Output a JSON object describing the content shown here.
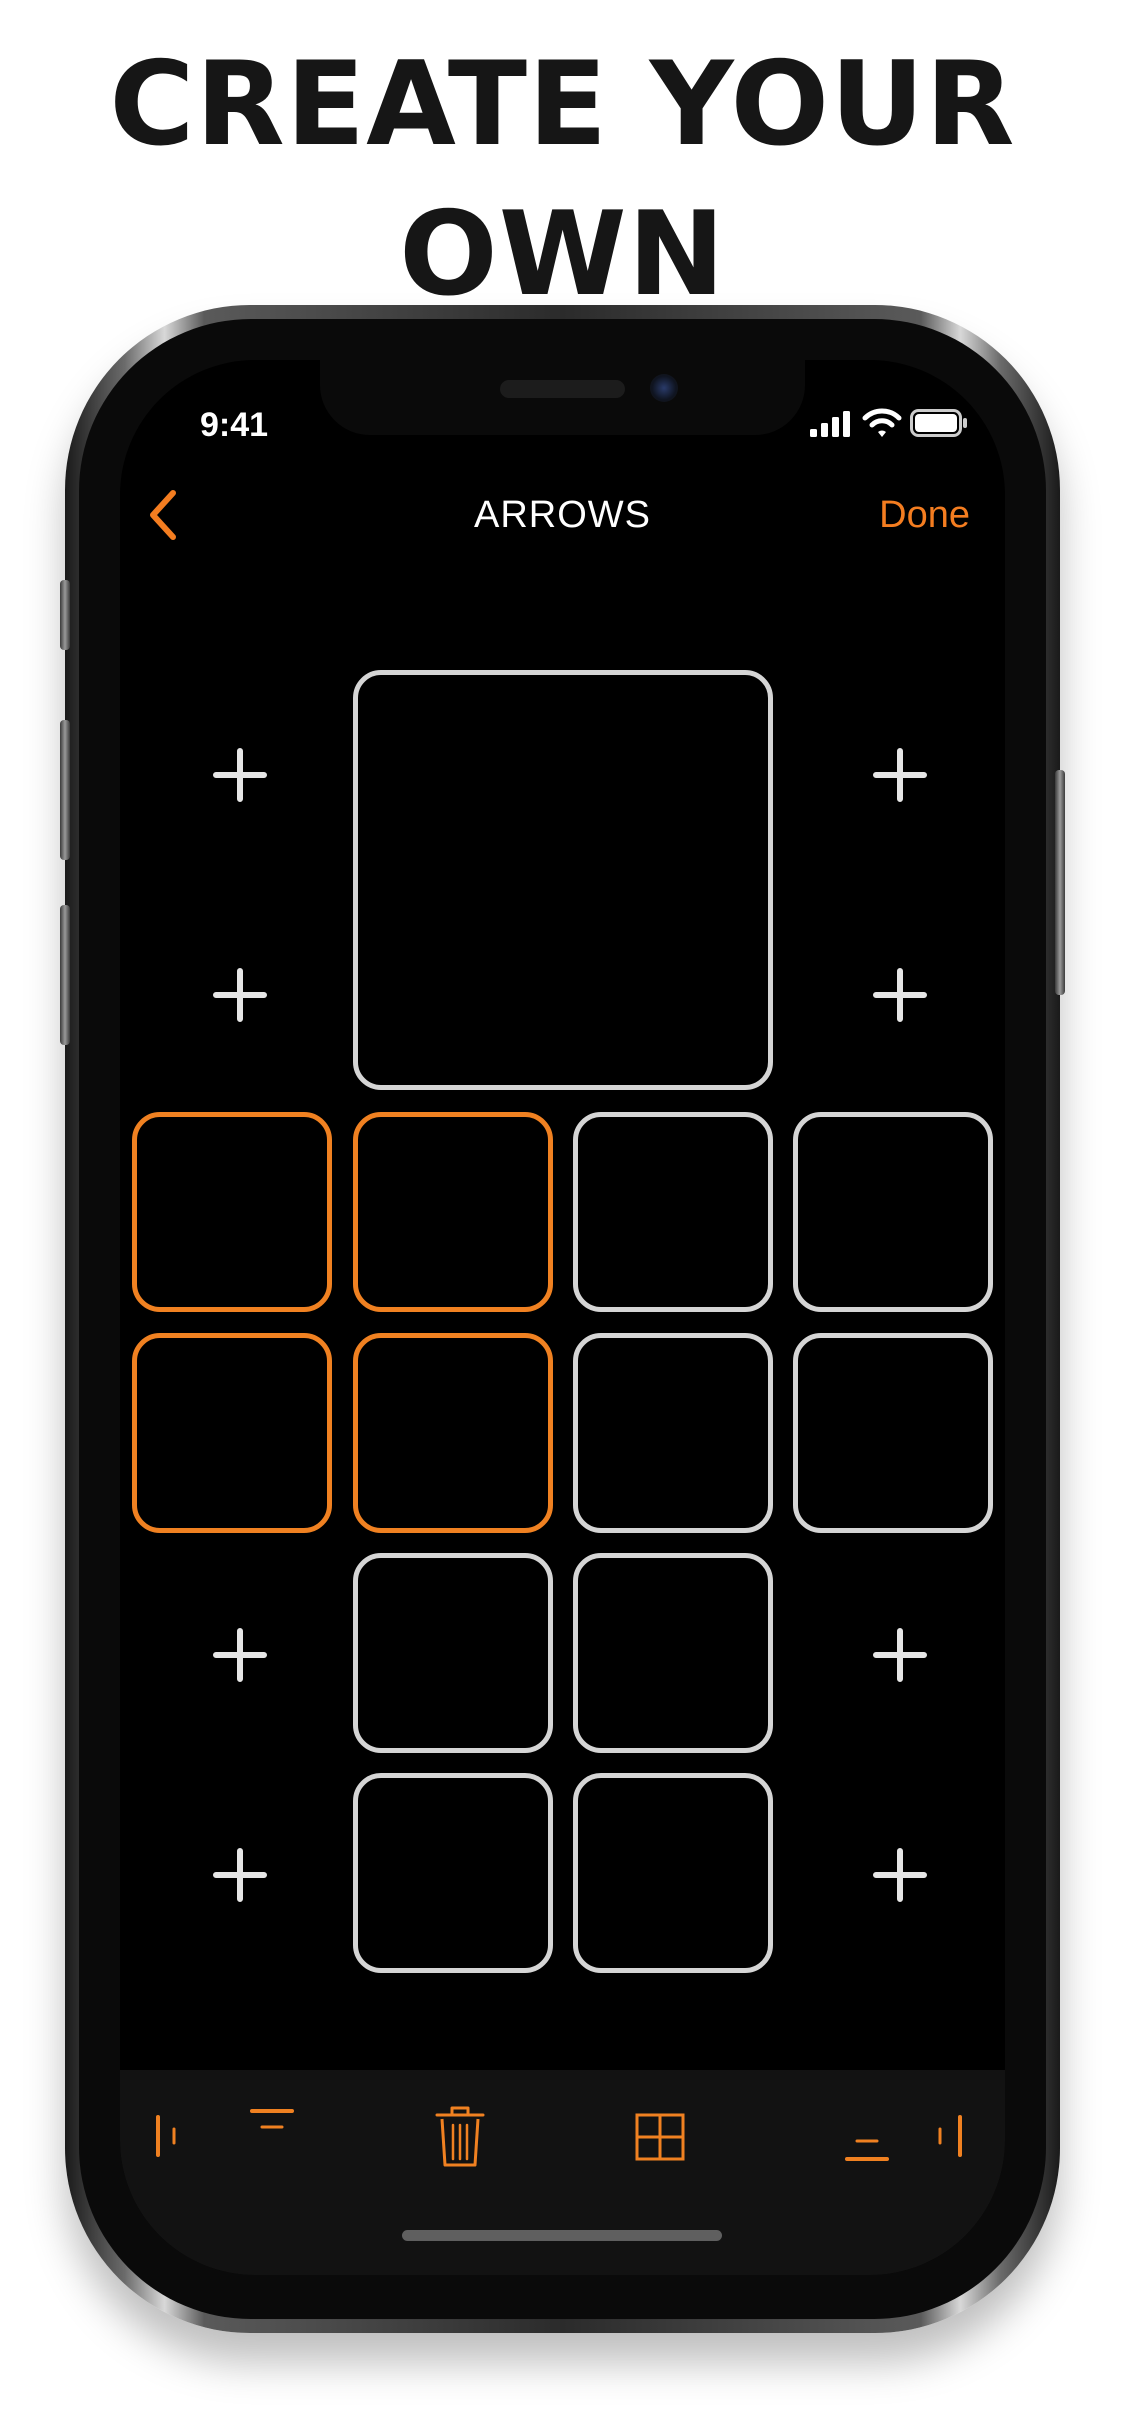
{
  "headline": "CREATE YOUR OWN",
  "status_bar": {
    "time": "9:41"
  },
  "nav": {
    "title": "ARROWS",
    "done_label": "Done"
  },
  "colors": {
    "accent": "#f08121",
    "tile_border": "#d5d5d5",
    "background": "#000000"
  },
  "grid": {
    "selected_tiles": [
      "r1c1",
      "r1c2",
      "r2c1",
      "r2c2"
    ],
    "icons": [
      "plus-icon"
    ]
  },
  "toolbar": {
    "icons": [
      "align-left-icon",
      "align-top-icon",
      "trash-icon",
      "grid-icon",
      "align-bottom-icon",
      "align-right-icon"
    ]
  }
}
